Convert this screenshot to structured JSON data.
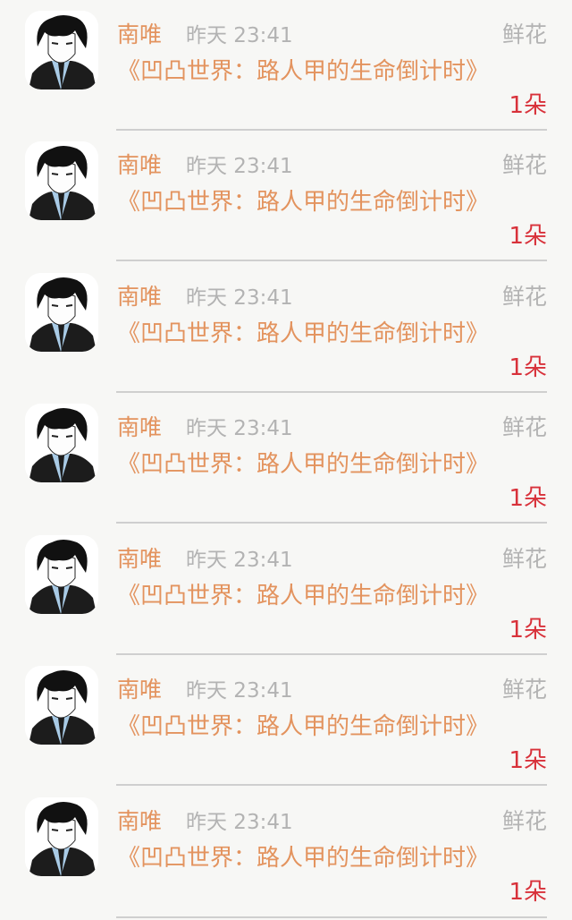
{
  "items": [
    {
      "name": "南唯",
      "time": "昨天 23:41",
      "type": "鲜花",
      "book": "《凹凸世界：路人甲的生命倒计时》",
      "count": "1朵"
    },
    {
      "name": "南唯",
      "time": "昨天 23:41",
      "type": "鲜花",
      "book": "《凹凸世界：路人甲的生命倒计时》",
      "count": "1朵"
    },
    {
      "name": "南唯",
      "time": "昨天 23:41",
      "type": "鲜花",
      "book": "《凹凸世界：路人甲的生命倒计时》",
      "count": "1朵"
    },
    {
      "name": "南唯",
      "time": "昨天 23:41",
      "type": "鲜花",
      "book": "《凹凸世界：路人甲的生命倒计时》",
      "count": "1朵"
    },
    {
      "name": "南唯",
      "time": "昨天 23:41",
      "type": "鲜花",
      "book": "《凹凸世界：路人甲的生命倒计时》",
      "count": "1朵"
    },
    {
      "name": "南唯",
      "time": "昨天 23:41",
      "type": "鲜花",
      "book": "《凹凸世界：路人甲的生命倒计时》",
      "count": "1朵"
    },
    {
      "name": "南唯",
      "time": "昨天 23:41",
      "type": "鲜花",
      "book": "《凹凸世界：路人甲的生命倒计时》",
      "count": "1朵"
    }
  ],
  "colors": {
    "background": "#f7f7f5",
    "name": "#e3935e",
    "book": "#e3935e",
    "muted": "#b3b3b3",
    "count": "#d8313a",
    "divider": "#cfcfcf"
  },
  "icons": {
    "avatar": "anime-avatar-icon"
  }
}
